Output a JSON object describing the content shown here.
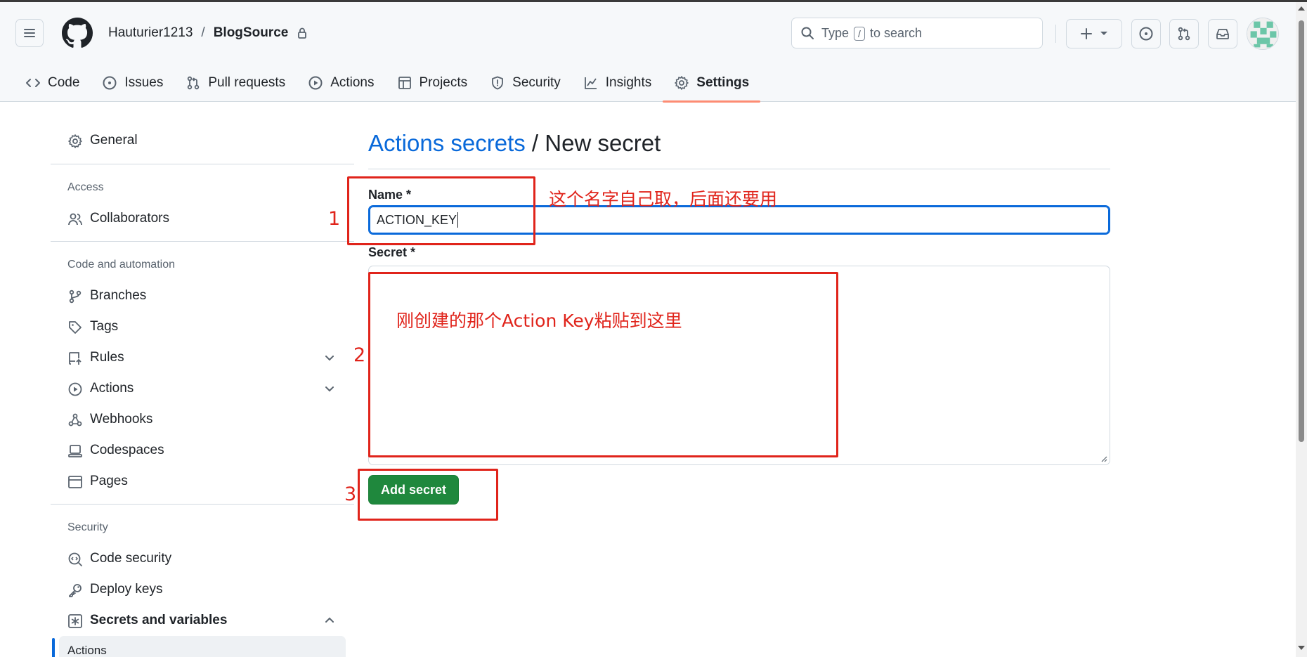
{
  "header": {
    "repo_owner": "Hauturier1213",
    "repo_separator": "/",
    "repo_name": "BlogSource",
    "search_prefix": "Type",
    "search_key": "/",
    "search_suffix": "to search"
  },
  "tabs": [
    {
      "label": "Code",
      "icon": "code-icon"
    },
    {
      "label": "Issues",
      "icon": "issue-opened-icon"
    },
    {
      "label": "Pull requests",
      "icon": "git-pull-request-icon"
    },
    {
      "label": "Actions",
      "icon": "play-icon"
    },
    {
      "label": "Projects",
      "icon": "table-icon"
    },
    {
      "label": "Security",
      "icon": "shield-icon"
    },
    {
      "label": "Insights",
      "icon": "graph-icon"
    },
    {
      "label": "Settings",
      "icon": "gear-icon",
      "active": true
    }
  ],
  "sidebar": {
    "general": "General",
    "access_title": "Access",
    "collaborators": "Collaborators",
    "code_automation_title": "Code and automation",
    "branches": "Branches",
    "tags": "Tags",
    "rules": "Rules",
    "actions": "Actions",
    "webhooks": "Webhooks",
    "codespaces": "Codespaces",
    "pages": "Pages",
    "security_title": "Security",
    "code_security": "Code security",
    "deploy_keys": "Deploy keys",
    "secrets_variables": "Secrets and variables",
    "sub_actions": "Actions"
  },
  "main": {
    "title_link": "Actions secrets",
    "title_sep": " / ",
    "title_rest": "New secret",
    "name_label": "Name *",
    "name_value": "ACTION_KEY",
    "secret_label": "Secret *",
    "secret_value": "",
    "add_button": "Add secret"
  },
  "annotations": {
    "num1": "1",
    "num2": "2",
    "num3": "3",
    "note1": "这个名字自己取，后面还要用",
    "note2": "刚创建的那个Action Key粘贴到这里"
  },
  "colors": {
    "accent_link": "#0969da",
    "active_tab_underline": "#fd8c73",
    "primary_button": "#1f883d",
    "annotation_red": "#e0241b"
  }
}
